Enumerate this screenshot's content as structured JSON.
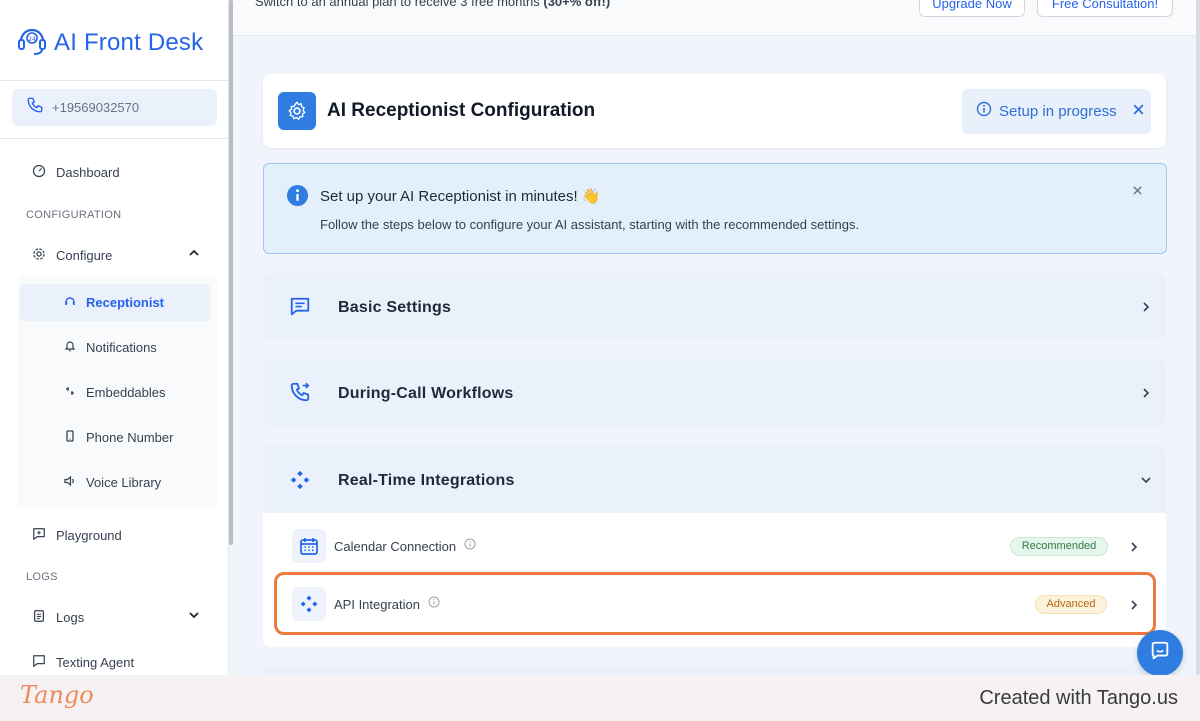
{
  "app": {
    "name": "AI Front Desk"
  },
  "sidebar": {
    "phone": "+19569032570",
    "dashboard": "Dashboard",
    "section_configuration": "CONFIGURATION",
    "configure": "Configure",
    "sub_items": [
      "Receptionist",
      "Notifications",
      "Embeddables",
      "Phone Number",
      "Voice Library"
    ],
    "playground": "Playground",
    "section_logs": "LOGS",
    "logs": "Logs",
    "texting_agent": "Texting Agent"
  },
  "topbar": {
    "text_prefix": "Switch to an annual plan to receive 3 free months",
    "text_bold": "(30+% off!)",
    "upgrade_button": "Upgrade Now",
    "consult_button": "Free Consultation!"
  },
  "header": {
    "title": "AI Receptionist Configuration",
    "status": "Setup in progress"
  },
  "info": {
    "title": "Set up your AI Receptionist in minutes! 👋",
    "description": "Follow the steps below to configure your AI assistant, starting with the recommended settings."
  },
  "sections": {
    "basic": "Basic Settings",
    "workflows": "During-Call Workflows",
    "integrations": "Real-Time Integrations"
  },
  "integrations": {
    "calendar": {
      "label": "Calendar Connection",
      "badge": "Recommended"
    },
    "api": {
      "label": "API Integration",
      "badge": "Advanced"
    }
  },
  "footer": {
    "logo": "Tango",
    "text": "Created with Tango.us"
  },
  "colors": {
    "accent": "#2563eb",
    "highlight": "#ef7a3e",
    "recommended_bg": "#e7f6ec",
    "advanced_bg": "#fdf3dd"
  }
}
